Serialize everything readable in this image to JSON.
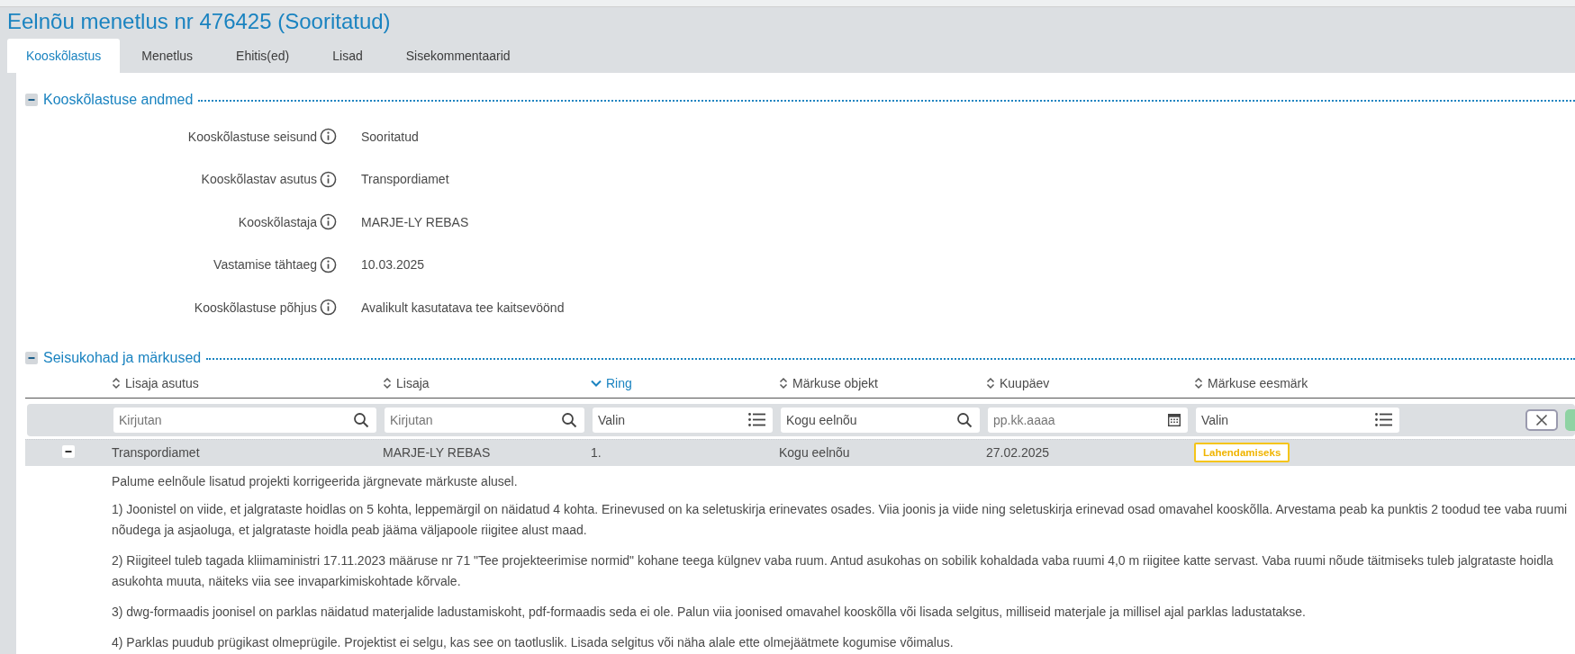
{
  "page": {
    "title": "Eelnõu menetlus nr 476425 (Sooritatud)"
  },
  "tabs": [
    {
      "label": "Kooskõlastus",
      "selected": true
    },
    {
      "label": "Menetlus",
      "selected": false
    },
    {
      "label": "Ehitis(ed)",
      "selected": false
    },
    {
      "label": "Lisad",
      "selected": false
    },
    {
      "label": "Sisekommentaarid",
      "selected": false
    }
  ],
  "details": {
    "title": "Kooskõlastuse andmed",
    "expanded": true,
    "fields": [
      {
        "label": "Kooskõlastuse seisund",
        "value": "Sooritatud"
      },
      {
        "label": "Kooskõlastav asutus",
        "value": "Transpordiamet"
      },
      {
        "label": "Kooskõlastaja",
        "value": "MARJE-LY REBAS"
      },
      {
        "label": "Vastamise tähtaeg",
        "value": "10.03.2025"
      },
      {
        "label": "Kooskõlastuse põhjus",
        "value": "Avalikult kasutatava tee kaitsevöönd"
      }
    ]
  },
  "remarks": {
    "title": "Seisukohad ja märkused",
    "expanded": true,
    "columns": [
      {
        "label": "Lisaja asutus",
        "sorted": false
      },
      {
        "label": "Lisaja",
        "sorted": false
      },
      {
        "label": "Ring",
        "sorted": true
      },
      {
        "label": "Märkuse objekt",
        "sorted": false
      },
      {
        "label": "Kuupäev",
        "sorted": false
      },
      {
        "label": "Märkuse eesmärk",
        "sorted": false
      }
    ],
    "filters": [
      {
        "kind": "search",
        "placeholder": "Kirjutan"
      },
      {
        "kind": "search",
        "placeholder": "Kirjutan"
      },
      {
        "kind": "select",
        "value": "Valin"
      },
      {
        "kind": "search",
        "value": "Kogu eelnõu"
      },
      {
        "kind": "date",
        "placeholder": "pp.kk.aaaa"
      },
      {
        "kind": "select",
        "value": "Valin"
      }
    ],
    "rows": [
      {
        "expanded": true,
        "cells": [
          "Transpordiamet",
          "MARJE-LY REBAS",
          "1.",
          "Kogu eelnõu",
          "27.02.2025"
        ],
        "tag": "Lahendamiseks",
        "paragraphs": [
          "Palume eelnõule lisatud projekti korrigeerida järgnevate märkuste alusel.",
          "1) Joonistel on viide, et jalgrataste hoidlas on 5 kohta, leppemärgil on näidatud 4 kohta. Erinevused on ka seletuskirja erinevates osades. Viia joonis ja viide ning seletuskirja erinevad osad omavahel kooskõlla. Arvestama peab ka punktis 2 toodud tee vaba ruumi nõudega ja asjaoluga, et jalgrataste hoidla peab jääma väljapoole riigitee alust maad.",
          "2) Riigiteel tuleb tagada kliimaministri 17.11.2023 määruse nr 71 \"Tee projekteerimise normid\" kohane teega külgnev vaba ruum. Antud asukohas on sobilik kohaldada vaba ruumi 4,0 m riigitee katte servast. Vaba ruumi nõude täitmiseks tuleb jalgrataste hoidla asukohta muuta, näiteks viia see invaparkimiskohtade kõrvale.",
          "3) dwg-formaadis joonisel on parklas näidatud materjalide ladustamiskoht, pdf-formaadis seda ei ole. Palun viia joonised omavahel kooskõlla või lisada selgitus, milliseid materjale ja millisel ajal parklas ladustatakse.",
          "4) Parklas puudub prügikast olmeprügile. Projektist ei selgu, kas see on taotluslik. Lisada selgitus või näha alale ette olmejäätmete kogumise võimalus."
        ]
      }
    ]
  }
}
